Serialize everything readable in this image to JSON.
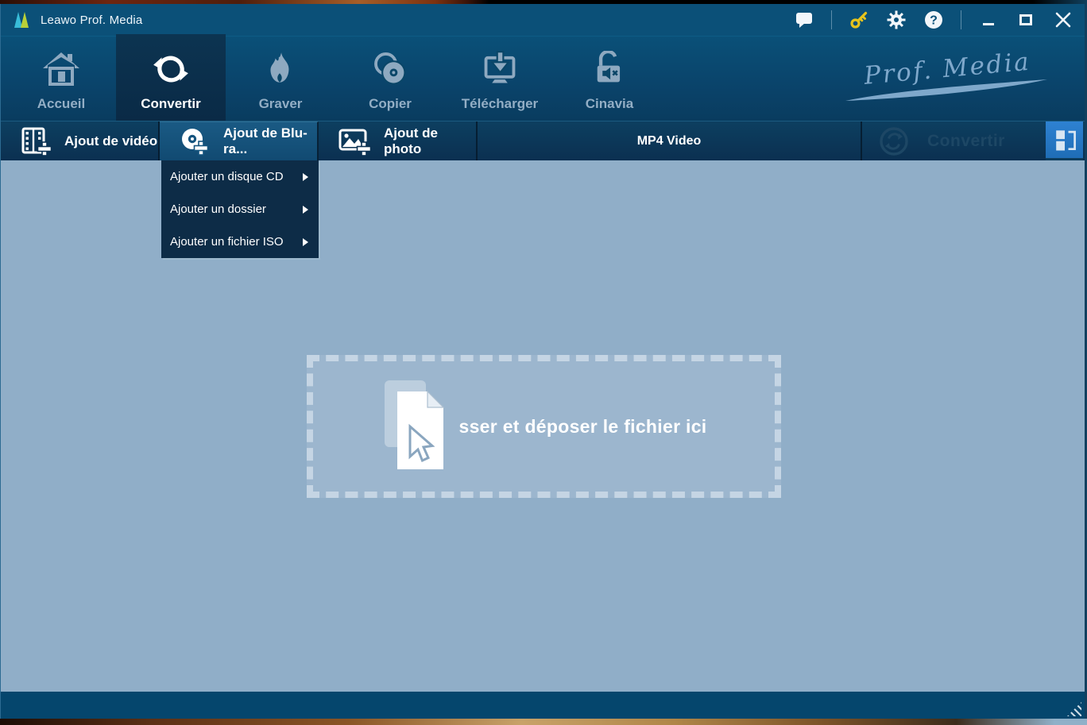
{
  "window": {
    "title": "Leawo Prof. Media"
  },
  "brand": {
    "script": "Prof. Media"
  },
  "titlebar": {
    "icons": [
      "message-icon",
      "key-icon",
      "settings-gear-icon",
      "help-icon"
    ],
    "controls": [
      "minimize",
      "maximize",
      "close"
    ]
  },
  "nav": {
    "tabs": [
      {
        "label": "Accueil",
        "icon": "home-icon",
        "active": false
      },
      {
        "label": "Convertir",
        "icon": "convert-sync-icon",
        "active": true
      },
      {
        "label": "Graver",
        "icon": "burn-flame-icon",
        "active": false
      },
      {
        "label": "Copier",
        "icon": "copy-discs-icon",
        "active": false
      },
      {
        "label": "Télécharger",
        "icon": "download-icon",
        "active": false
      },
      {
        "label": "Cinavia",
        "icon": "cinavia-unlock-icon",
        "active": false
      }
    ]
  },
  "toolbar": {
    "add_video": "Ajout de vidéo",
    "add_bluray": "Ajout de Blu-ra...",
    "add_photo": "Ajout de photo",
    "format": "MP4 Video",
    "convert": "Convertir"
  },
  "menu": {
    "items": [
      {
        "label": "Ajouter un disque CD"
      },
      {
        "label": "Ajouter un dossier"
      },
      {
        "label": "Ajouter un fichier ISO"
      }
    ]
  },
  "dropzone": {
    "text": "sser et déposer le fichier ici"
  },
  "colors": {
    "titlebar": "#0b5078",
    "header_gradient_bottom": "#093c5f",
    "active_tab": "#0a2a46",
    "toolbar_dark": "#0b3051",
    "bluray_highlight": "#15547e",
    "panel_button_blue": "#2478c8",
    "content_bg": "#90aec8",
    "bottom_bar": "#05466d",
    "menu_bg": "#0d2c47",
    "key_gold": "#e6c31c",
    "muted_icon": "#8ea9c0",
    "disabled_convert_text": "#1d4765"
  }
}
